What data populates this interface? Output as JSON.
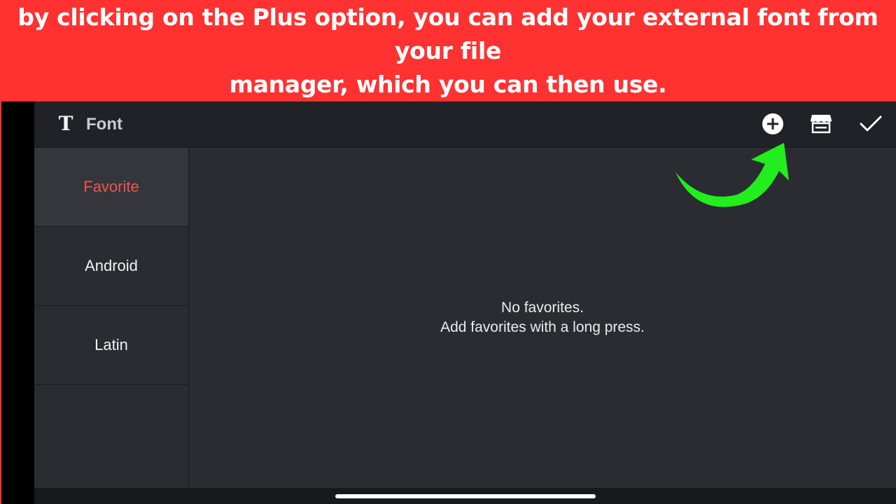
{
  "caption": {
    "line1": "by clicking on the Plus option, you can add your external font from your file",
    "line2": "manager, which you can then use."
  },
  "topbar": {
    "icon_glyph": "T",
    "title": "Font",
    "actions": [
      "plus-icon",
      "store-icon",
      "check-icon"
    ]
  },
  "sidebar": {
    "items": [
      {
        "label": "Favorite",
        "active": true
      },
      {
        "label": "Android",
        "active": false
      },
      {
        "label": "Latin",
        "active": false
      }
    ]
  },
  "content": {
    "empty_line1": "No favorites.",
    "empty_line2": "Add favorites with a long press."
  },
  "colors": {
    "caption_bg": "#ff3131",
    "active_label": "#ef5350",
    "annotation_arrow": "#22ee1e"
  }
}
